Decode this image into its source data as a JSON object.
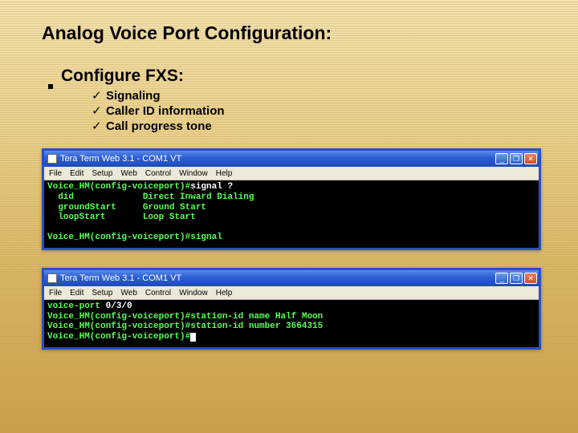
{
  "title": "Analog Voice Port Configuration:",
  "bullet": "Configure FXS:",
  "subs": [
    "Signaling",
    "Caller ID information",
    "Call progress tone"
  ],
  "win": {
    "title": "Tera Term Web 3.1 - COM1 VT",
    "menus": [
      "File",
      "Edit",
      "Setup",
      "Web",
      "Control",
      "Window",
      "Help"
    ],
    "btn_min": "_",
    "btn_max": "❐",
    "btn_close": "✕"
  },
  "term1": {
    "l1a": "Voice_HM(config-voiceport)#",
    "l1b": "signal ?",
    "l2": "  did             Direct Inward Dialing",
    "l3": "  groundStart     Ground Start",
    "l4": "  loopStart       Loop Start",
    "l5": "",
    "l6": "Voice_HM(config-voiceport)#signal"
  },
  "term2": {
    "l1a": "voice-port ",
    "l1b": "0/3/0",
    "l2": "Voice_HM(config-voiceport)#station-id name Half Moon",
    "l3": "Voice_HM(config-voiceport)#station-id number 3664315",
    "l4": "Voice_HM(config-voiceport)#"
  }
}
